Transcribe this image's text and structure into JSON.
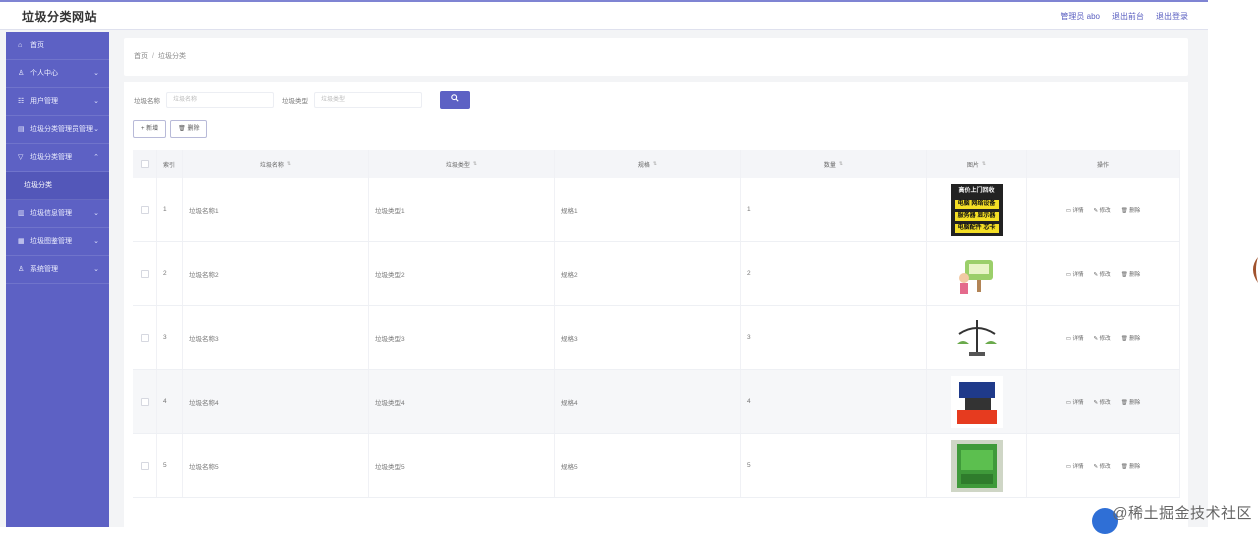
{
  "header": {
    "site_title": "垃圾分类网站",
    "links": [
      "管理员 abo",
      "退出前台",
      "退出登录"
    ]
  },
  "sidebar": {
    "items": [
      {
        "label": "首页",
        "icon": "home-icon",
        "has_children": false
      },
      {
        "label": "个人中心",
        "icon": "user-icon",
        "has_children": true
      },
      {
        "label": "用户管理",
        "icon": "users-icon",
        "has_children": true
      },
      {
        "label": "垃圾分类管理员管理",
        "icon": "list-icon",
        "has_children": true
      },
      {
        "label": "垃圾分类管理",
        "icon": "filter-icon",
        "has_children": true,
        "expanded": true,
        "children": [
          "垃圾分类"
        ]
      },
      {
        "label": "垃圾信息管理",
        "icon": "chart-icon",
        "has_children": true
      },
      {
        "label": "垃圾图鉴管理",
        "icon": "grid-icon",
        "has_children": true
      },
      {
        "label": "系统管理",
        "icon": "settings-icon",
        "has_children": true
      }
    ]
  },
  "breadcrumb": {
    "home": "首页",
    "separator": "/",
    "current": "垃圾分类"
  },
  "search": {
    "name_label": "垃圾名称",
    "name_placeholder": "垃圾名称",
    "type_label": "垃圾类型",
    "type_placeholder": "垃圾类型",
    "button_icon": "search-icon"
  },
  "actions": {
    "add": "+ 新增",
    "delete": "🗑 删除"
  },
  "table": {
    "columns": [
      "索引",
      "垃圾名称",
      "垃圾类型",
      "规格",
      "数量",
      "图片",
      "操作"
    ],
    "rows": [
      {
        "index": "1",
        "name": "垃圾名称1",
        "type": "垃圾类型1",
        "spec": "规格1",
        "num": "1"
      },
      {
        "index": "2",
        "name": "垃圾名称2",
        "type": "垃圾类型2",
        "spec": "规格2",
        "num": "2"
      },
      {
        "index": "3",
        "name": "垃圾名称3",
        "type": "垃圾类型3",
        "spec": "规格3",
        "num": "3"
      },
      {
        "index": "4",
        "name": "垃圾名称4",
        "type": "垃圾类型4",
        "spec": "规格4",
        "num": "4"
      },
      {
        "index": "5",
        "name": "垃圾名称5",
        "type": "垃圾类型5",
        "spec": "规格5",
        "num": "5"
      }
    ],
    "row_ops": [
      "详情",
      "修改",
      "删除"
    ],
    "image1_lines": [
      "高价上门回收",
      "电脑 网络设备",
      "服务器 显示器",
      "电脑配件 芯卡"
    ]
  },
  "watermark": "@稀土掘金技术社区",
  "colors": {
    "accent": "#5d61c4",
    "sidebar": "#5d61c4"
  }
}
